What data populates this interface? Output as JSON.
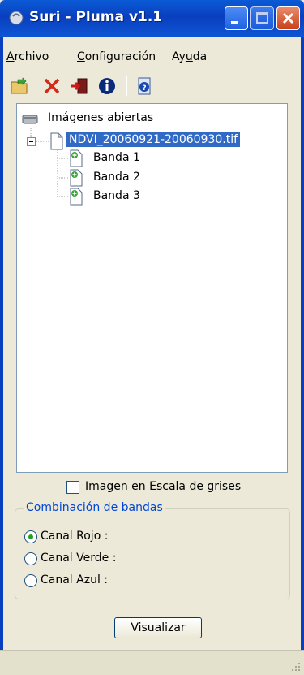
{
  "window": {
    "title": "Suri - Pluma v1.1"
  },
  "menu": {
    "items": [
      {
        "label": "Archivo",
        "accel": "A",
        "rest": "rchivo"
      },
      {
        "label": "Configuración",
        "accel": "C",
        "rest": "onfiguración"
      },
      {
        "label": "Ayuda",
        "accel_pre": "Ay",
        "accel": "u",
        "rest": "da"
      }
    ]
  },
  "toolbar": {
    "icons": [
      "open-folder-icon",
      "delete-icon",
      "exit-icon",
      "info-icon",
      "help-icon"
    ]
  },
  "tree": {
    "root": "Imágenes abiertas",
    "image": "NDVI_20060921-20060930.tif",
    "bands": [
      "Banda 1",
      "Banda 2",
      "Banda 3"
    ]
  },
  "options": {
    "grayscale_label": "Imagen en Escala de grises",
    "grayscale_checked": false
  },
  "bands_group": {
    "title": "Combinación de bandas",
    "channels": [
      {
        "label": "Canal Rojo :",
        "selected": true
      },
      {
        "label": "Canal Verde :",
        "selected": false
      },
      {
        "label": "Canal Azul :",
        "selected": false
      }
    ]
  },
  "actions": {
    "visualize": "Visualizar"
  },
  "colors": {
    "titlebar": "#0a3fbf",
    "selection": "#316ac5",
    "group_title": "#0046d5"
  }
}
